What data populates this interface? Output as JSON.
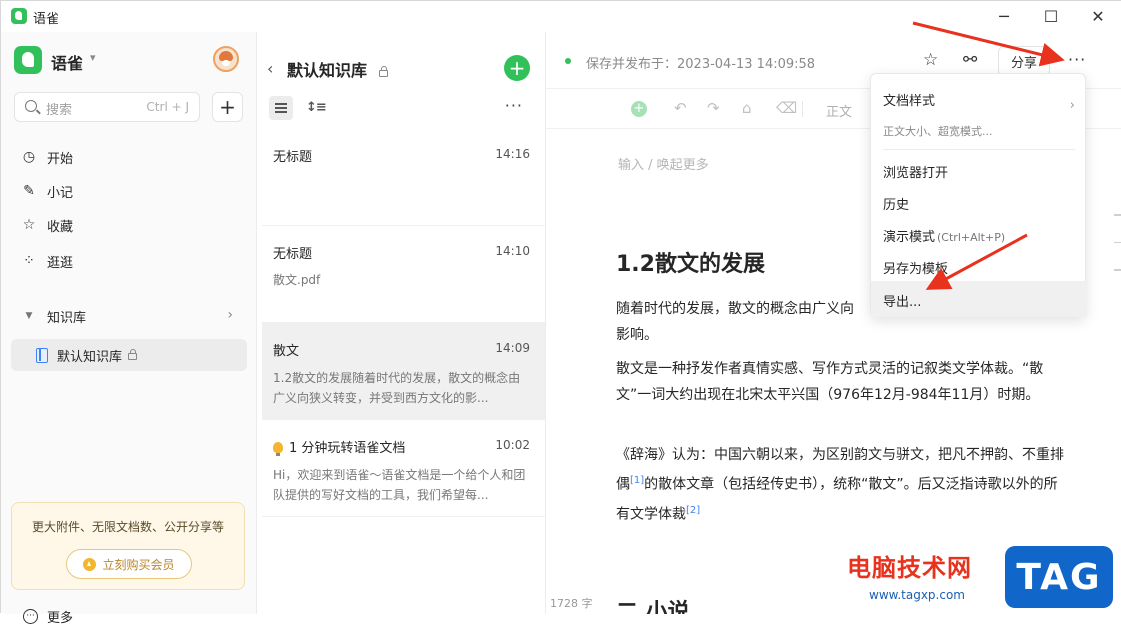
{
  "window": {
    "title": "语雀",
    "controls": {
      "minimize": "─",
      "maximize": "☐",
      "close": "✕"
    }
  },
  "sidebar": {
    "brand": "语雀",
    "search": {
      "placeholder": "搜索",
      "shortcut": "Ctrl + J"
    },
    "nav": [
      {
        "label": "开始",
        "icon": "clock-icon"
      },
      {
        "label": "小记",
        "icon": "pen-icon"
      },
      {
        "label": "收藏",
        "icon": "star-icon"
      },
      {
        "label": "逛逛",
        "icon": "grid-icon"
      }
    ],
    "knowledge_section": "知识库",
    "knowledge_item": "默认知识库",
    "promo": {
      "text": "更大附件、无限文档数、公开分享等",
      "button": "立刻购买会员"
    },
    "more": "更多"
  },
  "doclist": {
    "title": "默认知识库",
    "docs": [
      {
        "title": "无标题",
        "time": "14:16",
        "snippet": ""
      },
      {
        "title": "无标题",
        "time": "14:10",
        "snippet": "散文.pdf"
      },
      {
        "title": "散文",
        "time": "14:09",
        "snippet": "1.2散文的发展随着时代的发展，散文的概念由广义向狭义转变，并受到西方文化的影..."
      },
      {
        "title": "1 分钟玩转语雀文档",
        "time": "10:02",
        "snippet": "Hi，欢迎来到语雀～语雀文档是一个给个人和团队提供的写好文档的工具，我们希望每..."
      }
    ]
  },
  "editor": {
    "status": "保存并发布于：2023-04-13 14:09:58",
    "share": "分享",
    "toolbar_style": "正文",
    "placeholder": "输入 / 唤起更多",
    "heading": "1.2散文的发展",
    "p1": "随着时代的发展，散文的概念由广义向",
    "p1b": "影响。",
    "p2": "散文是一种抒发作者真情实感、写作方式灵活的记叙类文学体裁。“散文”一词大约出现在北宋太平兴国（976年12月-984年11月）时期。",
    "p3a": "《辞海》认为：中国六朝以来，为区别韵文与骈文，把凡不押韵、不重排偶",
    "ref1": "[1]",
    "p3b": "的散体文章（包括经传史书），统称“散文”。后又泛指诗歌以外的所有文学体裁",
    "ref2": "[2]",
    "wordcount": "1728 字",
    "next_heading": "二 小说"
  },
  "menu": {
    "doc_style": "文档样式",
    "doc_style_sub": "正文大小、超宽模式...",
    "open_browser": "浏览器打开",
    "history": "历史",
    "present": "演示模式",
    "present_hint": "(Ctrl+Alt+P)",
    "save_template": "另存为模板",
    "export": "导出..."
  },
  "watermark": {
    "cn": "电脑技术网",
    "url": "www.tagxp.com",
    "tag": "TAG"
  },
  "colors": {
    "brand_green": "#31c05a",
    "arrow_red": "#e8321e",
    "link_blue": "#3e82f7"
  }
}
